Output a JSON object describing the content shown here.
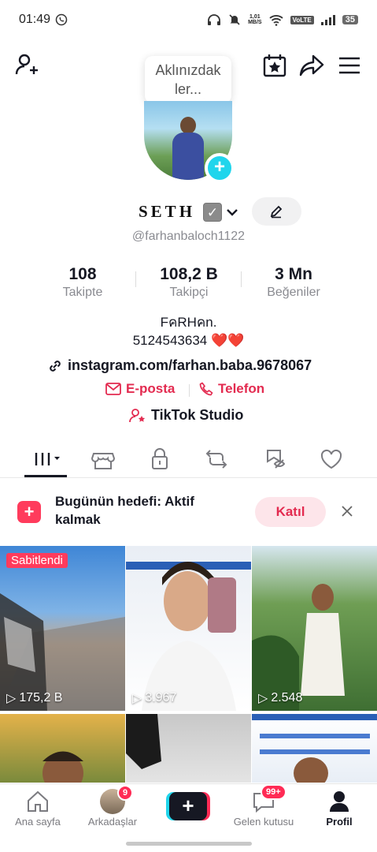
{
  "status_bar": {
    "time": "01:49",
    "net_speed_top": "1,01",
    "net_speed_unit": "MB/S",
    "volte": "VoLTE",
    "battery": "35"
  },
  "header": {
    "tooltip": "Aklınızdak ler...",
    "tooltip_line1": "Aklınızdak",
    "tooltip_line2": "ler..."
  },
  "profile": {
    "name": "SETH",
    "handle": "@farhanbaloch1122",
    "stats": [
      {
        "value": "108",
        "label": "Takipte"
      },
      {
        "value": "108,2 B",
        "label": "Takipçi"
      },
      {
        "value": "3 Mn",
        "label": "Beğeniler"
      }
    ],
    "bio_line1": "FคRHคn.",
    "bio_line2": "5124543634 ❤️❤️",
    "link": "instagram.com/farhan.baba.9678067",
    "email_label": "E-posta",
    "phone_label": "Telefon",
    "studio_label": "TikTok Studio"
  },
  "goal_banner": {
    "text": "Bugünün hedefi: Aktif kalmak",
    "line1": "Bugünün hedefi: Aktif",
    "line2": "kalmak",
    "button": "Katıl"
  },
  "videos": [
    {
      "pinned": "Sabitlendi",
      "views": "175,2 B"
    },
    {
      "views": "3.967"
    },
    {
      "views": "2.548"
    }
  ],
  "bottom_nav": {
    "home": "Ana sayfa",
    "friends": "Arkadaşlar",
    "friends_badge": "9",
    "inbox": "Gelen kutusu",
    "inbox_badge": "99+",
    "profile": "Profil"
  },
  "colors": {
    "accent": "#ff3b5c",
    "link_red": "#e32b50",
    "cyan": "#20d5ec"
  }
}
